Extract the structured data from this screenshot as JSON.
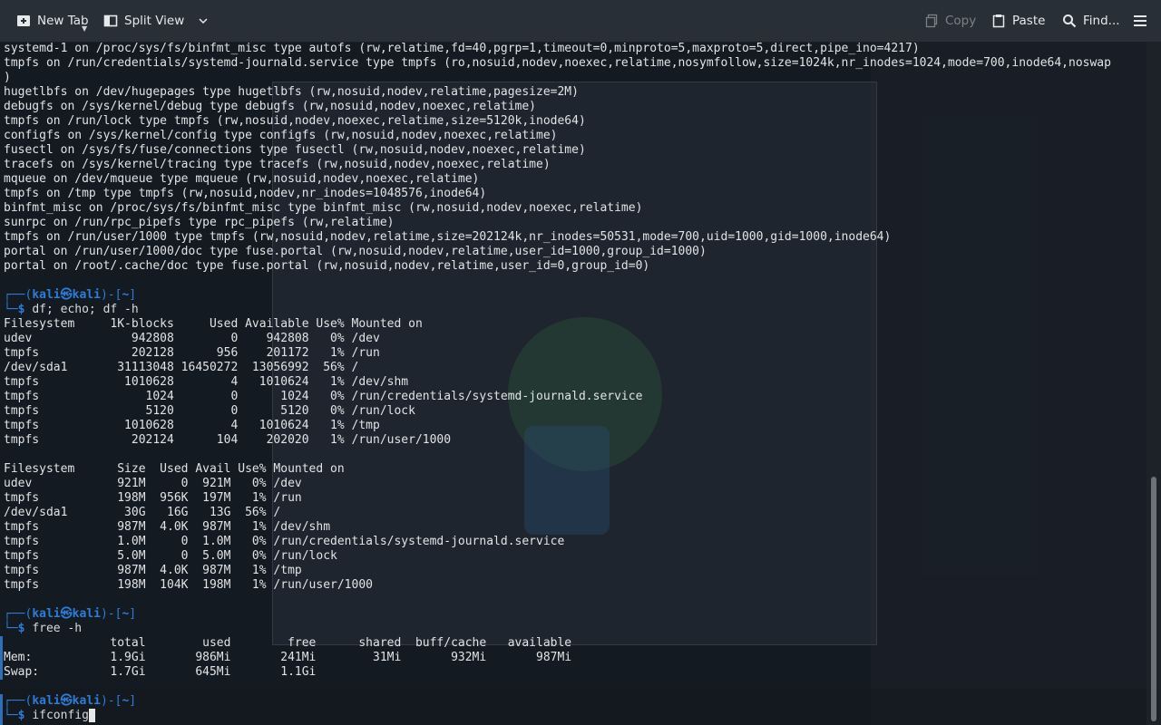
{
  "toolbar": {
    "new_tab": "New Tab",
    "split_view": "Split View",
    "copy": "Copy",
    "paste": "Paste",
    "find": "Find..."
  },
  "prompt": {
    "user": "kali",
    "host": "kali",
    "dir": "~"
  },
  "mount_lines": [
    "systemd-1 on /proc/sys/fs/binfmt_misc type autofs (rw,relatime,fd=40,pgrp=1,timeout=0,minproto=5,maxproto=5,direct,pipe_ino=4217)",
    "tmpfs on /run/credentials/systemd-journald.service type tmpfs (ro,nosuid,nodev,noexec,relatime,nosymfollow,size=1024k,nr_inodes=1024,mode=700,inode64,noswap",
    ")",
    "hugetlbfs on /dev/hugepages type hugetlbfs (rw,nosuid,nodev,relatime,pagesize=2M)",
    "debugfs on /sys/kernel/debug type debugfs (rw,nosuid,nodev,noexec,relatime)",
    "tmpfs on /run/lock type tmpfs (rw,nosuid,nodev,noexec,relatime,size=5120k,inode64)",
    "configfs on /sys/kernel/config type configfs (rw,nosuid,nodev,noexec,relatime)",
    "fusectl on /sys/fs/fuse/connections type fusectl (rw,nosuid,nodev,noexec,relatime)",
    "tracefs on /sys/kernel/tracing type tracefs (rw,nosuid,nodev,noexec,relatime)",
    "mqueue on /dev/mqueue type mqueue (rw,nosuid,nodev,noexec,relatime)",
    "tmpfs on /tmp type tmpfs (rw,nosuid,nodev,nr_inodes=1048576,inode64)",
    "binfmt_misc on /proc/sys/fs/binfmt_misc type binfmt_misc (rw,nosuid,nodev,noexec,relatime)",
    "sunrpc on /run/rpc_pipefs type rpc_pipefs (rw,relatime)",
    "tmpfs on /run/user/1000 type tmpfs (rw,nosuid,nodev,relatime,size=202124k,nr_inodes=50531,mode=700,uid=1000,gid=1000,inode64)",
    "portal on /run/user/1000/doc type fuse.portal (rw,nosuid,nodev,relatime,user_id=1000,group_id=1000)",
    "portal on /root/.cache/doc type fuse.portal (rw,nosuid,nodev,relatime,user_id=0,group_id=0)"
  ],
  "cmd1": "df; echo; df -h",
  "df_lines": [
    "Filesystem     1K-blocks     Used Available Use% Mounted on",
    "udev              942808        0    942808   0% /dev",
    "tmpfs             202128      956    201172   1% /run",
    "/dev/sda1       31113048 16450272  13056992  56% /",
    "tmpfs            1010628        4   1010624   1% /dev/shm",
    "tmpfs               1024        0      1024   0% /run/credentials/systemd-journald.service",
    "tmpfs               5120        0      5120   0% /run/lock",
    "tmpfs            1010628        4   1010624   1% /tmp",
    "tmpfs             202124      104    202020   1% /run/user/1000"
  ],
  "dfh_lines": [
    "Filesystem      Size  Used Avail Use% Mounted on",
    "udev            921M     0  921M   0% /dev",
    "tmpfs           198M  956K  197M   1% /run",
    "/dev/sda1        30G   16G   13G  56% /",
    "tmpfs           987M  4.0K  987M   1% /dev/shm",
    "tmpfs           1.0M     0  1.0M   0% /run/credentials/systemd-journald.service",
    "tmpfs           5.0M     0  5.0M   0% /run/lock",
    "tmpfs           987M  4.0K  987M   1% /tmp",
    "tmpfs           198M  104K  198M   1% /run/user/1000"
  ],
  "cmd2": "free -h",
  "free_lines": [
    "               total        used        free      shared  buff/cache   available",
    "Mem:           1.9Gi       986Mi       241Mi        31Mi       932Mi       987Mi",
    "Swap:          1.7Gi       645Mi       1.1Gi"
  ],
  "cmd3": "ifconfig"
}
